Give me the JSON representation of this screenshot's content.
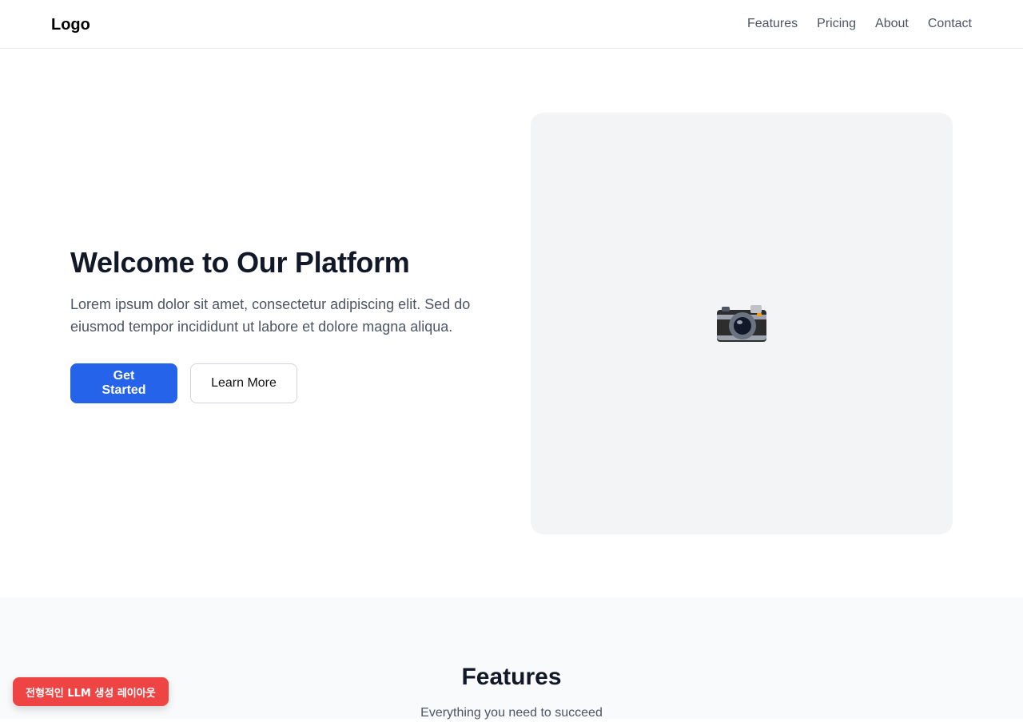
{
  "header": {
    "logo": "Logo",
    "nav": [
      {
        "label": "Features"
      },
      {
        "label": "Pricing"
      },
      {
        "label": "About"
      },
      {
        "label": "Contact"
      }
    ]
  },
  "hero": {
    "title": "Welcome to Our Platform",
    "subtitle": "Lorem ipsum dolor sit amet, consectetur adipiscing elit. Sed do eiusmod tempor incididunt ut labore et dolore magna aliqua.",
    "primary_button": "Get Started",
    "secondary_button": "Learn More",
    "image_icon": "camera-icon"
  },
  "features": {
    "title": "Features",
    "subtitle": "Everything you need to succeed"
  },
  "badge": {
    "label": "전형적인 LLM 생성 레이아웃"
  },
  "colors": {
    "primary": "#2563eb",
    "badge": "#ef4444",
    "image_bg": "#f3f4f6",
    "features_bg": "#f9fafb"
  }
}
